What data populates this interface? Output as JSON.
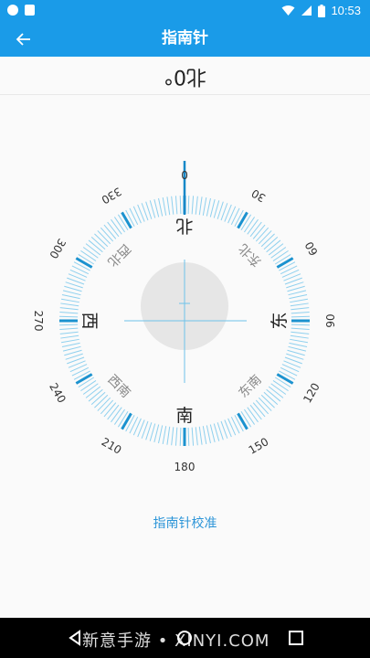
{
  "status_bar": {
    "time": "10:53"
  },
  "app_bar": {
    "title": "指南针"
  },
  "heading": {
    "reading": "北0°"
  },
  "compass": {
    "degree_labels": [
      "0",
      "30",
      "60",
      "90",
      "120",
      "150",
      "180",
      "210",
      "240",
      "270",
      "300",
      "330"
    ],
    "cardinal_labels": [
      "北",
      "东",
      "南",
      "西"
    ],
    "intercardinal_labels": [
      "东北",
      "东南",
      "西南",
      "西北"
    ],
    "accent_color": "#2da6dc",
    "center_color": "#e6e6e6"
  },
  "calibrate": {
    "label": "指南针校准"
  },
  "nav_bar": {
    "watermark": "新意手游 • XINYI.COM"
  }
}
